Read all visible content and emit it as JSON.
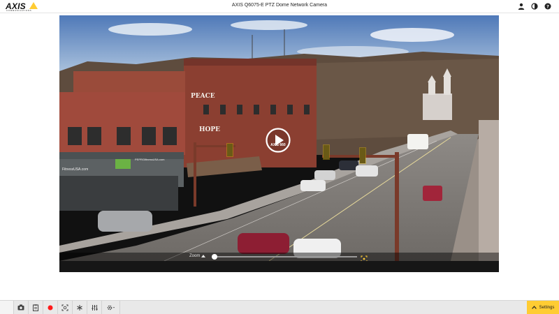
{
  "header": {
    "logo_text": "AXIS",
    "logo_subtext": "COMMUNICATIONS",
    "title": "AXIS Q6075-E PTZ Dome Network Camera",
    "icons": [
      "user-icon",
      "contrast-icon",
      "help-icon"
    ]
  },
  "viewer": {
    "play_label": "AXIS 660",
    "zoom_label": "Zoom",
    "zoom_level": 0.0,
    "signs": {
      "fitness": "FitnessUSA.com",
      "fitness_url": "PEPRGfitnessUSA.com",
      "peace": "PEACE",
      "hope": "HOPE"
    }
  },
  "toolbar": {
    "tools": [
      "camera-icon",
      "clipboard-icon",
      "record-icon",
      "focus-icon",
      "asterisk-icon",
      "levels-icon",
      "gear-icon"
    ],
    "settings_label": "Settings"
  },
  "colors": {
    "accent": "#ffcc33",
    "record": "#ff1a1a"
  }
}
